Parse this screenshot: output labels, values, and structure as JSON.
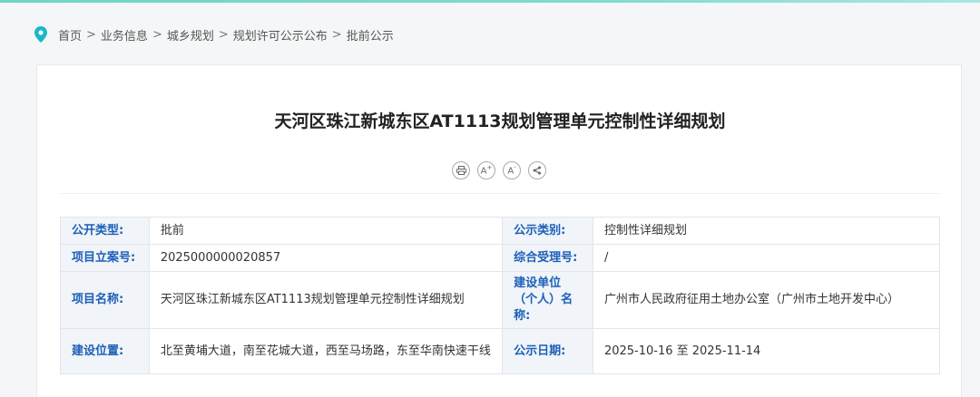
{
  "breadcrumb": [
    "首页",
    "业务信息",
    "城乡规划",
    "规划许可公示公布",
    "批前公示"
  ],
  "breadcrumb_sep": ">",
  "title": "天河区珠江新城东区AT1113规划管理单元控制性详细规划",
  "tools": {
    "print": "print-icon",
    "font_up": "A",
    "font_up_sup": "+",
    "font_down": "A",
    "font_down_sup": "-",
    "share": "share-icon"
  },
  "info": {
    "public_type_label": "公开类型:",
    "public_type_value": "批前",
    "notice_category_label": "公示类别:",
    "notice_category_value": "控制性详细规划",
    "project_case_no_label": "项目立案号:",
    "project_case_no_value": "2025000000020857",
    "acceptance_no_label": "综合受理号:",
    "acceptance_no_value": "/",
    "project_name_label": "项目名称:",
    "project_name_value": "天河区珠江新城东区AT1113规划管理单元控制性详细规划",
    "builder_label": "建设单位（个人）名称:",
    "builder_value": "广州市人民政府征用土地办公室（广州市土地开发中心）",
    "location_label": "建设位置:",
    "location_value": "北至黄埔大道，南至花城大道，西至马场路，东至华南快速干线",
    "notice_date_label": "公示日期:",
    "notice_date_value": "2025-10-16 至 2025-11-14"
  },
  "colors": {
    "accent": "#1c5fb8",
    "pin": "#19b7c9",
    "top_bar": "#6fd5c8"
  }
}
